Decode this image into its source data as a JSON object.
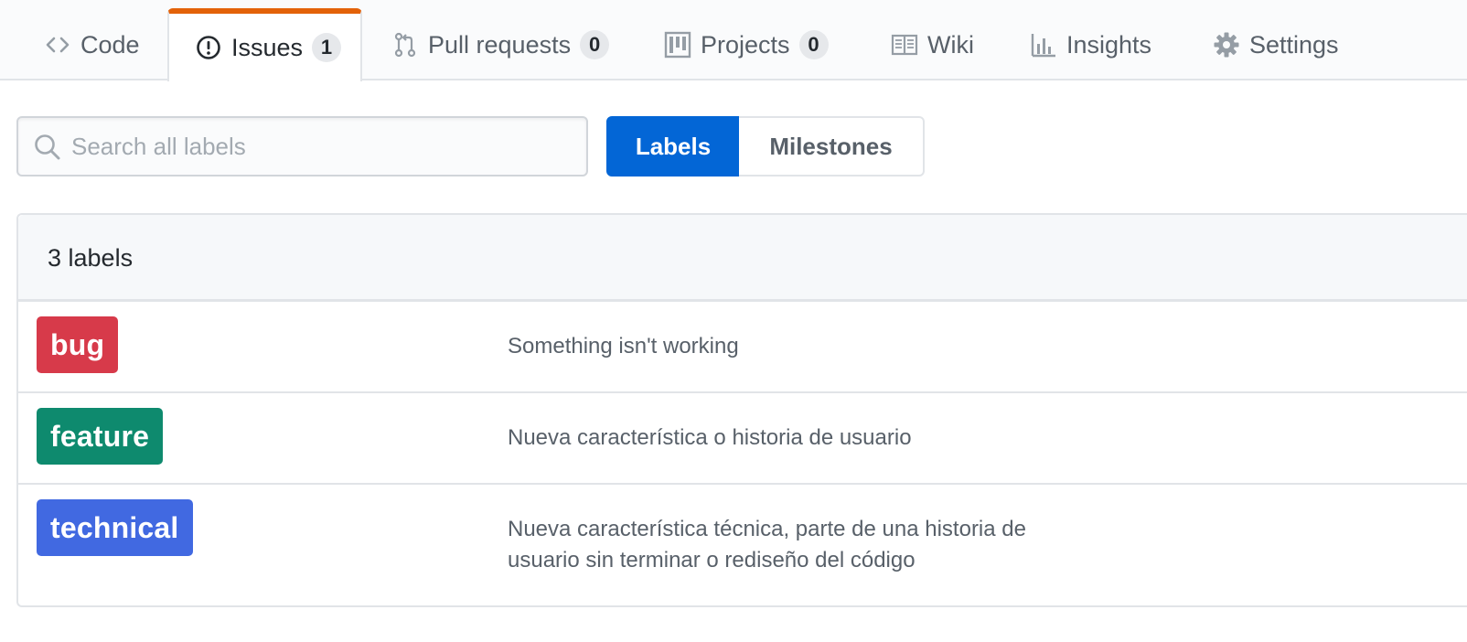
{
  "tabs": [
    {
      "label": "Code",
      "icon": "code-icon"
    },
    {
      "label": "Issues",
      "icon": "issue-opened-icon",
      "count": "1",
      "selected": true
    },
    {
      "label": "Pull requests",
      "icon": "git-pull-request-icon",
      "count": "0"
    },
    {
      "label": "Projects",
      "icon": "project-icon",
      "count": "0"
    },
    {
      "label": "Wiki",
      "icon": "book-icon"
    },
    {
      "label": "Insights",
      "icon": "graph-icon"
    },
    {
      "label": "Settings",
      "icon": "gear-icon"
    }
  ],
  "search": {
    "placeholder": "Search all labels",
    "value": ""
  },
  "subnav": {
    "labels": "Labels",
    "milestones": "Milestones"
  },
  "labels_box": {
    "count_text": "3 labels",
    "labels": [
      {
        "name": "bug",
        "color": "#d73a4a",
        "description": "Something isn't working"
      },
      {
        "name": "feature",
        "color": "#0e8a6e",
        "description": "Nueva característica o historia de usuario"
      },
      {
        "name": "technical",
        "color": "#4169e1",
        "description": "Nueva característica técnica, parte de una historia de usuario sin terminar o rediseño del código"
      }
    ]
  },
  "colors": {
    "accent": "#0366d6",
    "selected_tab_border": "#e36209"
  }
}
